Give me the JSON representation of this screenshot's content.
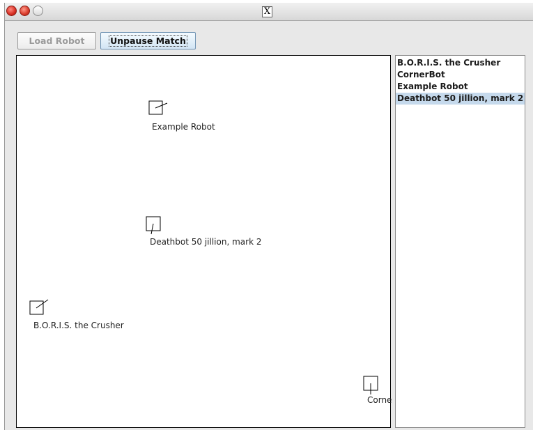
{
  "window": {
    "title_icon_text": "X"
  },
  "toolbar": {
    "load_robot_label": "Load Robot",
    "unpause_match_label": "Unpause Match"
  },
  "arena": {
    "robots": [
      {
        "name": "Example Robot",
        "label": "Example Robot"
      },
      {
        "name": "Deathbot 50 jillion, mark 2",
        "label": "Deathbot 50 jillion, mark 2"
      },
      {
        "name": "B.O.R.I.S. the Crusher",
        "label": "B.O.R.I.S. the Crusher"
      },
      {
        "name": "CornerBot",
        "label": "Corne"
      }
    ]
  },
  "robot_list": {
    "items": [
      "B.O.R.I.S. the Crusher",
      "CornerBot",
      "Example Robot",
      "Deathbot 50 jillion, mark 2"
    ],
    "selected_index": 3
  }
}
